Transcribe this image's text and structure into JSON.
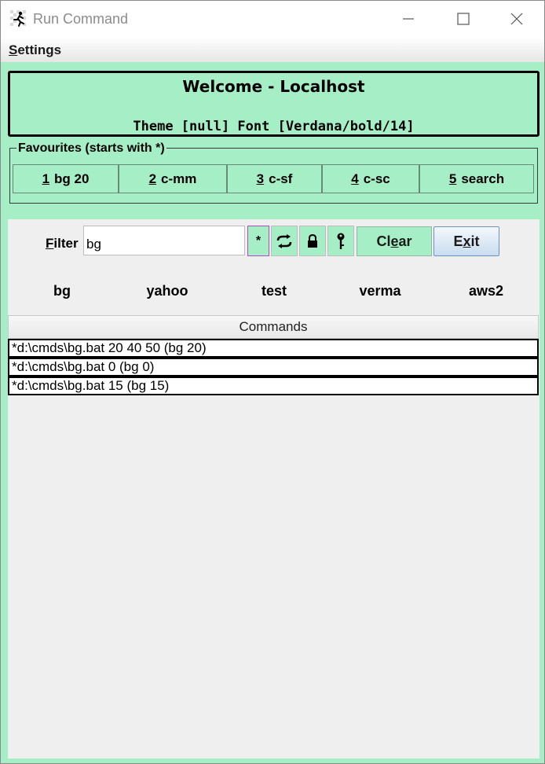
{
  "window": {
    "title": "Run Command"
  },
  "menu": {
    "settings_first": "S",
    "settings_rest": "ettings"
  },
  "welcome": {
    "title": "Welcome - Localhost",
    "subtitle": "Theme [null] Font [Verdana/bold/14]"
  },
  "favourites": {
    "legend": "Favourites (starts with *)",
    "items": [
      {
        "num": "1",
        "label": "bg 20"
      },
      {
        "num": "2",
        "label": "c-mm"
      },
      {
        "num": "3",
        "label": "c-sf"
      },
      {
        "num": "4",
        "label": "c-sc"
      },
      {
        "num": "5",
        "label": "search"
      }
    ]
  },
  "filter": {
    "label_first": "F",
    "label_rest": "ilter",
    "value": "bg",
    "star_label": "*"
  },
  "buttons": {
    "clear_a": "Cl",
    "clear_u": "e",
    "clear_b": "ar",
    "exit_a": "E",
    "exit_u": "x",
    "exit_b": "it"
  },
  "quick_links": [
    "bg",
    "yahoo",
    "test",
    "verma",
    "aws2"
  ],
  "commands": {
    "header": "Commands",
    "rows": [
      "*d:\\cmds\\bg.bat 20 40 50 (bg 20)",
      "*d:\\cmds\\bg.bat 0 (bg 0)",
      "*d:\\cmds\\bg.bat 15 (bg 15)"
    ]
  },
  "colors": {
    "theme_green": "#a6efc6",
    "exit_blue": "#c9dcef",
    "star_border": "#b24bc9"
  }
}
